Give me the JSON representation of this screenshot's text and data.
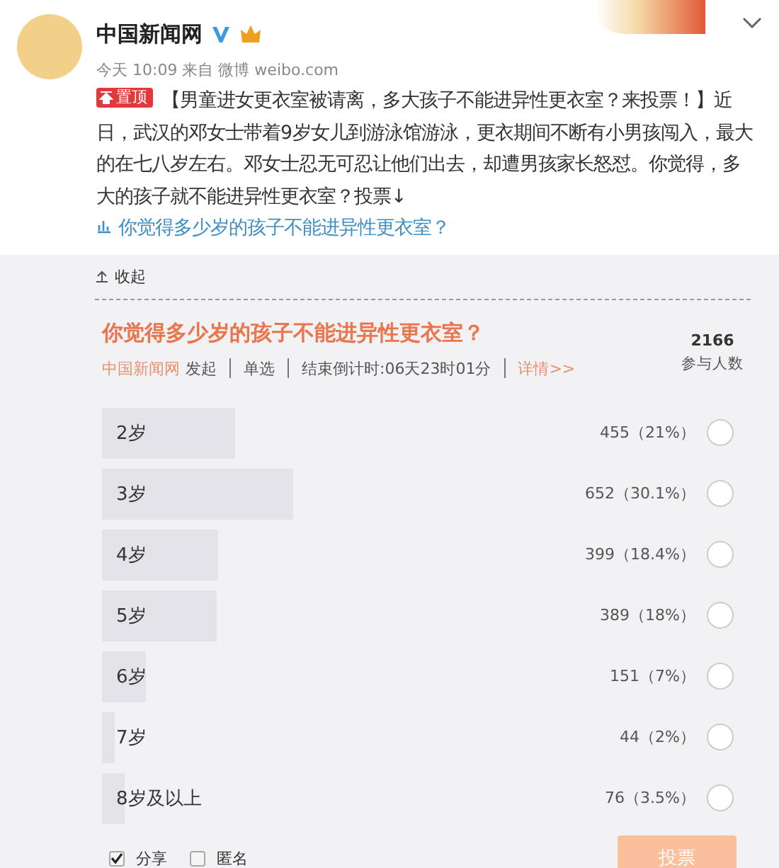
{
  "account": {
    "name": "中国新闻网",
    "verified": true,
    "meta": "今天 10:09 来自 微博 weibo.com"
  },
  "post": {
    "pinned_label": "置顶",
    "text": "【男童进女更衣室被请离，多大孩子不能进异性更衣室？来投票！】近日，武汉的邓女士带着9岁女儿到游泳馆游泳，更衣期间不断有小男孩闯入，最大的在七八岁左右。邓女士忍无可忍让他们出去，却遭男孩家长怒怼。你觉得，多大的孩子就不能进异性更衣室？投票↓",
    "link": "你觉得多少岁的孩子不能进异性更衣室？"
  },
  "collapse": "收起",
  "poll": {
    "title": "你觉得多少岁的孩子不能进异性更衣室？",
    "initiator": "中国新闻网",
    "initiated": "发起",
    "mode": "单选",
    "countdown": "结束倒计时:06天23时01分",
    "details": "详情>>",
    "count": "2166",
    "count_label": "参与人数",
    "options": [
      {
        "label": "2岁",
        "result": "455（21%）",
        "level": 0.21,
        "selected": false
      },
      {
        "label": "3岁",
        "result": "652（30.1%）",
        "level": 0.301,
        "selected": false
      },
      {
        "label": "4岁",
        "result": "399（18.4%）",
        "level": 0.184,
        "selected": false
      },
      {
        "label": "5岁",
        "result": "389（18%）",
        "level": 0.18,
        "selected": false
      },
      {
        "label": "6岁",
        "result": "151（7%）",
        "level": 0.07,
        "selected": false
      },
      {
        "label": "7岁",
        "result": "44（2%）",
        "level": 0.02,
        "selected": false
      },
      {
        "label": "8岁及以上",
        "result": "76（3.5%）",
        "level": 0.035,
        "selected": false
      }
    ],
    "share": {
      "label": "分享",
      "checked": true
    },
    "anonymous": {
      "label": "匿名",
      "checked": false
    },
    "vote_button": {
      "label": "投票",
      "disabled": true
    }
  }
}
